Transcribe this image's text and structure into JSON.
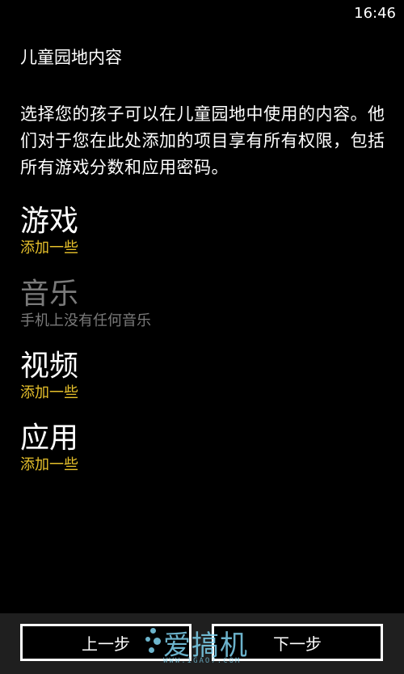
{
  "status_bar": {
    "time": "16:46"
  },
  "header": {
    "title": "儿童园地内容"
  },
  "description": "选择您的孩子可以在儿童园地中使用的内容。他们对于您在此处添加的项目享有所有权限，包括所有游戏分数和应用密码。",
  "sections": [
    {
      "title": "游戏",
      "subtitle": "添加一些",
      "enabled": true
    },
    {
      "title": "音乐",
      "subtitle": "手机上没有任何音乐",
      "enabled": false
    },
    {
      "title": "视频",
      "subtitle": "添加一些",
      "enabled": true
    },
    {
      "title": "应用",
      "subtitle": "添加一些",
      "enabled": true
    }
  ],
  "app_bar": {
    "prev_label": "上一步",
    "next_label": "下一步"
  },
  "watermark": {
    "text": "爱搞机",
    "url": "WWW.IGAO7.COM"
  },
  "colors": {
    "accent": "#e6c02b",
    "disabled": "#7a7a7a",
    "background": "#000000",
    "app_bar": "#1f1f1f"
  }
}
